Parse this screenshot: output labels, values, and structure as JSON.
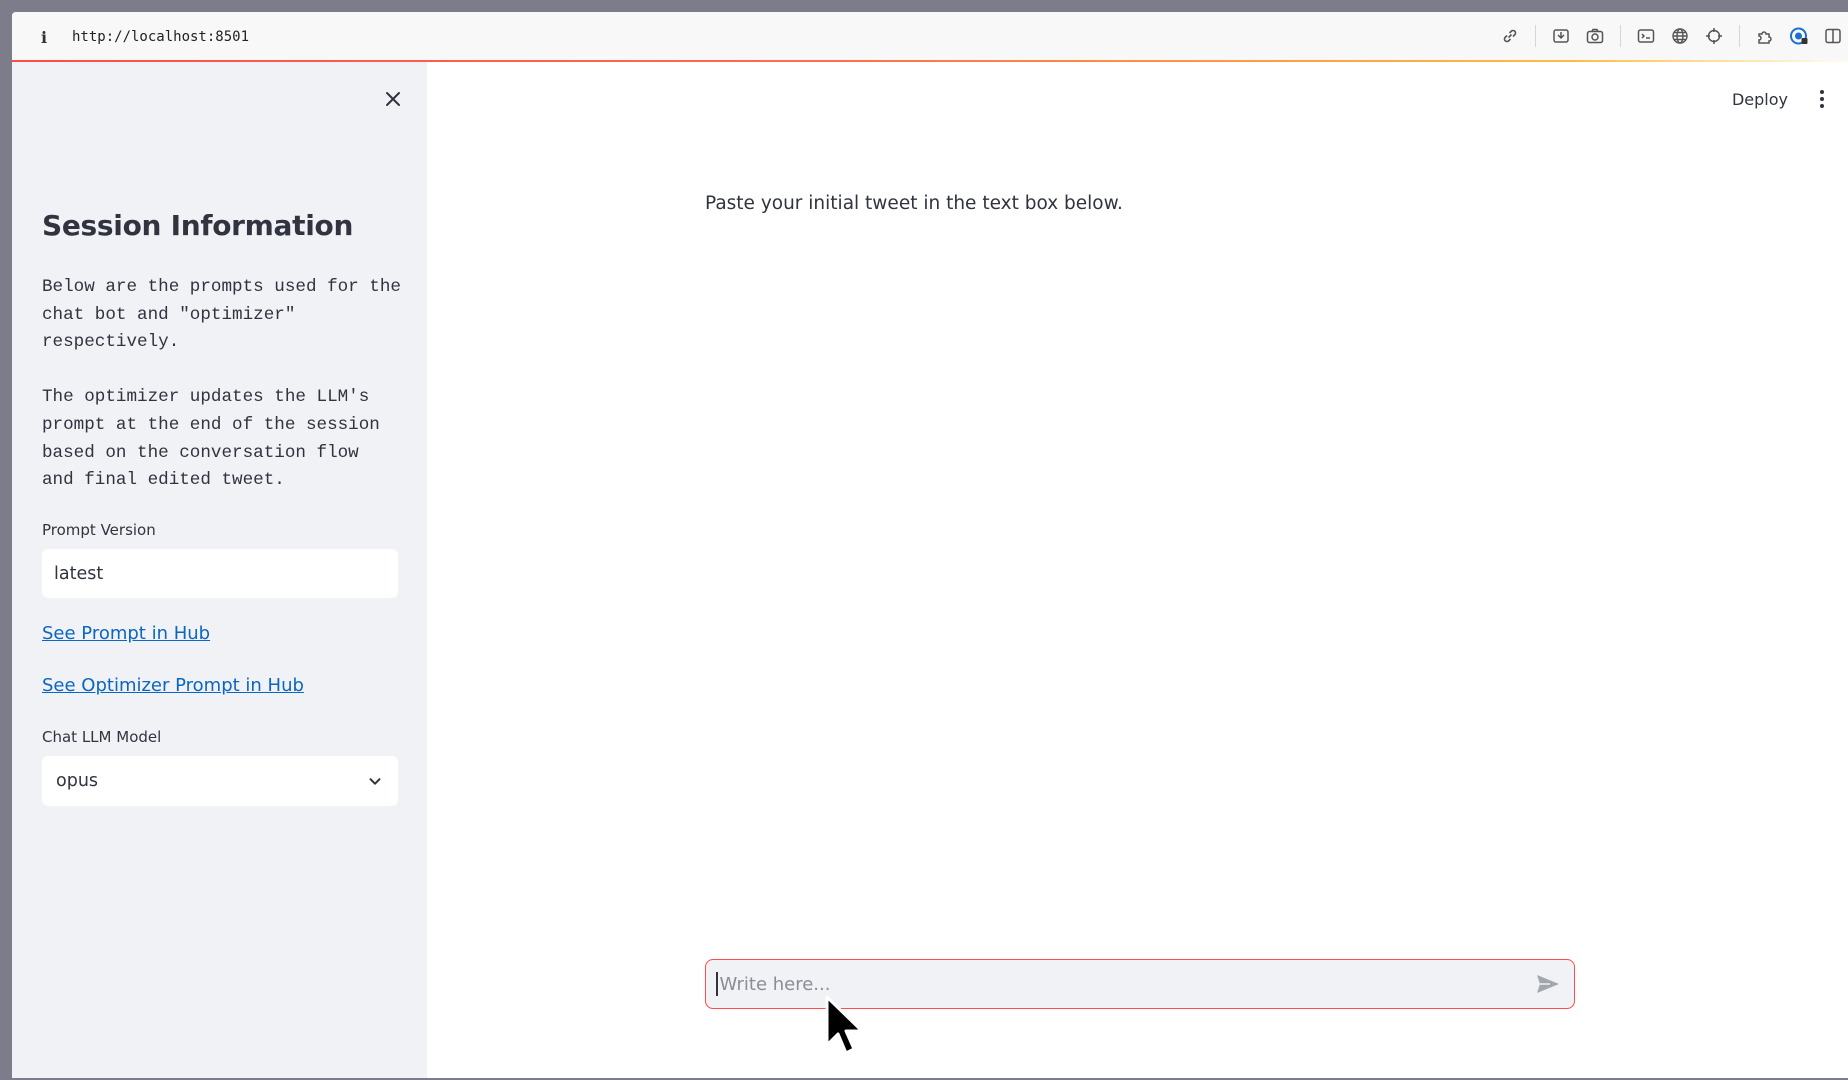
{
  "browser": {
    "url": "http://localhost:8501",
    "tools": [
      "link-icon",
      "save-page-icon",
      "camera-icon",
      "terminal-icon",
      "globe-icon",
      "crosshair-icon",
      "extensions-icon",
      "account-icon",
      "split-view-icon"
    ]
  },
  "sidebar": {
    "title": "Session Information",
    "description": "Below are the prompts used for the\nchat bot and \"optimizer\"\nrespectively.\n\nThe optimizer updates the LLM's\nprompt at the end of the session\nbased on the conversation flow\nand final edited tweet.",
    "prompt_version_label": "Prompt Version",
    "prompt_version_value": "latest",
    "link_prompt": "See Prompt in Hub",
    "link_optimizer": "See Optimizer Prompt in Hub",
    "model_label": "Chat LLM Model",
    "model_value": "opus"
  },
  "header": {
    "deploy_label": "Deploy"
  },
  "main": {
    "intro_text": "Paste your initial tweet in the text box below.",
    "chat_placeholder": "Write here..."
  },
  "colors": {
    "accent": "#ff4b4b",
    "sidebar_bg": "#f0f2f6",
    "link": "#0b66c2",
    "text": "#31333f"
  }
}
